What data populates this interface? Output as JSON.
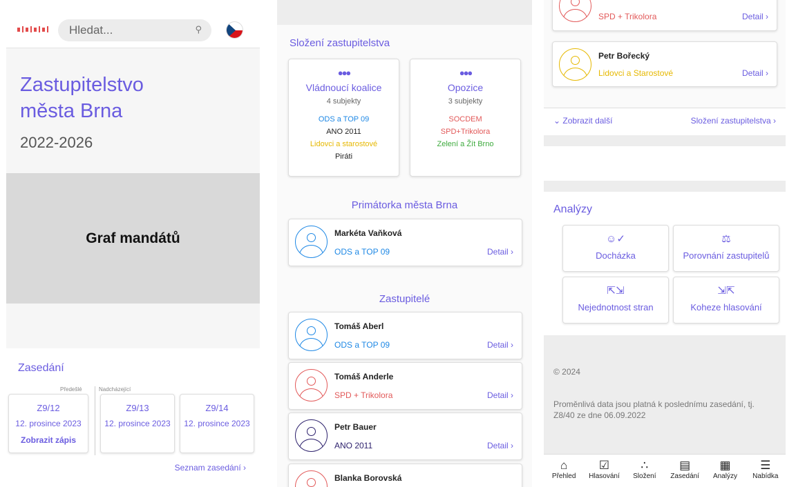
{
  "panel1": {
    "search_placeholder": "Hledat...",
    "title": "Zastupitelstvo města Brna",
    "years": "2022-2026",
    "graph_label": "Graf mandátů",
    "sessions_title": "Zasedání",
    "prev_label": "Předešlé",
    "next_label": "Nadcházející",
    "meetings": [
      {
        "code": "Z9/12",
        "date": "12. prosince 2023",
        "link": "Zobrazit zápis"
      },
      {
        "code": "Z9/13",
        "date": "12. prosince 2023"
      },
      {
        "code": "Z9/14",
        "date": "12. prosince 2023"
      }
    ],
    "list_link": "Seznam zasedání ›"
  },
  "panel2": {
    "composition_title": "Složení zastupitelstva",
    "coalition": {
      "name": "Vládnoucí koalice",
      "count": "4 subjekty",
      "parties": [
        "ODS a TOP 09",
        "ANO 2011",
        "Lidovci a starostové",
        "Piráti"
      ]
    },
    "opposition": {
      "name": "Opozice",
      "count": "3 subjekty",
      "parties": [
        "SOCDEM",
        "SPD+Trikolora",
        "Zelení a Žít Brno"
      ]
    },
    "mayor_title": "Primátorka města Brna",
    "mayor": {
      "name": "Markéta Vaňková",
      "party": "ODS a TOP 09",
      "detail": "Detail ›"
    },
    "members_title": "Zastupitelé",
    "members": [
      {
        "name": "Tomáš Aberl",
        "party": "ODS a TOP 09",
        "detail": "Detail ›"
      },
      {
        "name": "Tomáš Anderle",
        "party": "SPD + Trikolora",
        "detail": "Detail ›"
      },
      {
        "name": "Petr Bauer",
        "party": "ANO 2011",
        "detail": "Detail ›"
      },
      {
        "name": "Blanka Borovská",
        "party": "",
        "detail": ""
      }
    ]
  },
  "panel3": {
    "top_card": {
      "party": "SPD + Trikolora",
      "detail": "Detail ›"
    },
    "card2": {
      "name": "Petr Bořecký",
      "party": "Lidovci a Starostové",
      "detail": "Detail ›"
    },
    "show_more": "⌄ Zobrazit další",
    "composition_link": "Složení zastupitelstva ›",
    "analyses_title": "Analýzy",
    "tiles": [
      "Docházka",
      "Porovnání zastupitelů",
      "Nejednotnost stran",
      "Koheze hlasování"
    ],
    "copyright": "© 2024",
    "note": "Proměnlivá data jsou platná k poslednímu zasedání, tj. Z8/40 ze dne 06.09.2022",
    "nav": [
      "Přehled",
      "Hlasování",
      "Složení",
      "Zasedání",
      "Analýzy",
      "Nabídka"
    ]
  },
  "colors": {
    "accent": "#6a5ce0",
    "ods": "#1e88e5",
    "spd": "#e25858",
    "lidovci": "#e6b800",
    "ano": "#2b1f6b",
    "zeleni": "#3daa3d"
  }
}
